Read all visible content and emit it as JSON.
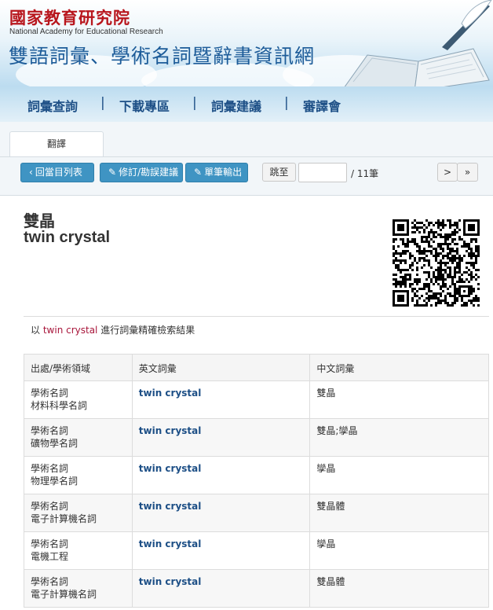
{
  "header": {
    "org_name": "國家教育研究院",
    "org_name_en": "National Academy for Educational Research",
    "site_title": "雙語詞彙、學術名詞暨辭書資訊網"
  },
  "nav": {
    "items": [
      {
        "label": "詞彙查詢"
      },
      {
        "label": "下載專區"
      },
      {
        "label": "詞彙建議"
      },
      {
        "label": "審譯會"
      }
    ],
    "separator": "|"
  },
  "tabs": {
    "active": "翻譯"
  },
  "toolbar": {
    "back_label": "回當目列表",
    "edit_label": "修訂/勘誤建議",
    "export_label": "單筆輸出",
    "jump_label": "跳至",
    "jump_value": "",
    "total_label": "/ 11筆",
    "next_label": ">",
    "last_label": "»"
  },
  "entry": {
    "term_zh": "雙晶",
    "term_en": "twin crystal",
    "result_prefix": "以",
    "result_keyword": "twin crystal",
    "result_suffix": "進行詞彙精確檢索結果"
  },
  "table": {
    "headers": [
      "出處/學術領域",
      "英文詞彙",
      "中文詞彙"
    ],
    "rows": [
      {
        "source": "學術名詞",
        "field": "材料科學名詞",
        "en": "twin crystal",
        "zh": "雙晶"
      },
      {
        "source": "學術名詞",
        "field": "礦物學名詞",
        "en": "twin crystal",
        "zh": "雙晶;孿晶"
      },
      {
        "source": "學術名詞",
        "field": "物理學名詞",
        "en": "twin crystal",
        "zh": "孿晶"
      },
      {
        "source": "學術名詞",
        "field": "電子計算機名詞",
        "en": "twin crystal",
        "zh": "雙晶體"
      },
      {
        "source": "學術名詞",
        "field": "電機工程",
        "en": "twin crystal",
        "zh": "孿晶"
      },
      {
        "source": "學術名詞",
        "field": "電子計算機名詞",
        "en": "twin crystal",
        "zh": "雙晶體"
      }
    ]
  },
  "colors": {
    "brand_red": "#b8161d",
    "brand_blue": "#1d5c99",
    "button_blue": "#3f94c3",
    "keyword": "#a8153a"
  }
}
